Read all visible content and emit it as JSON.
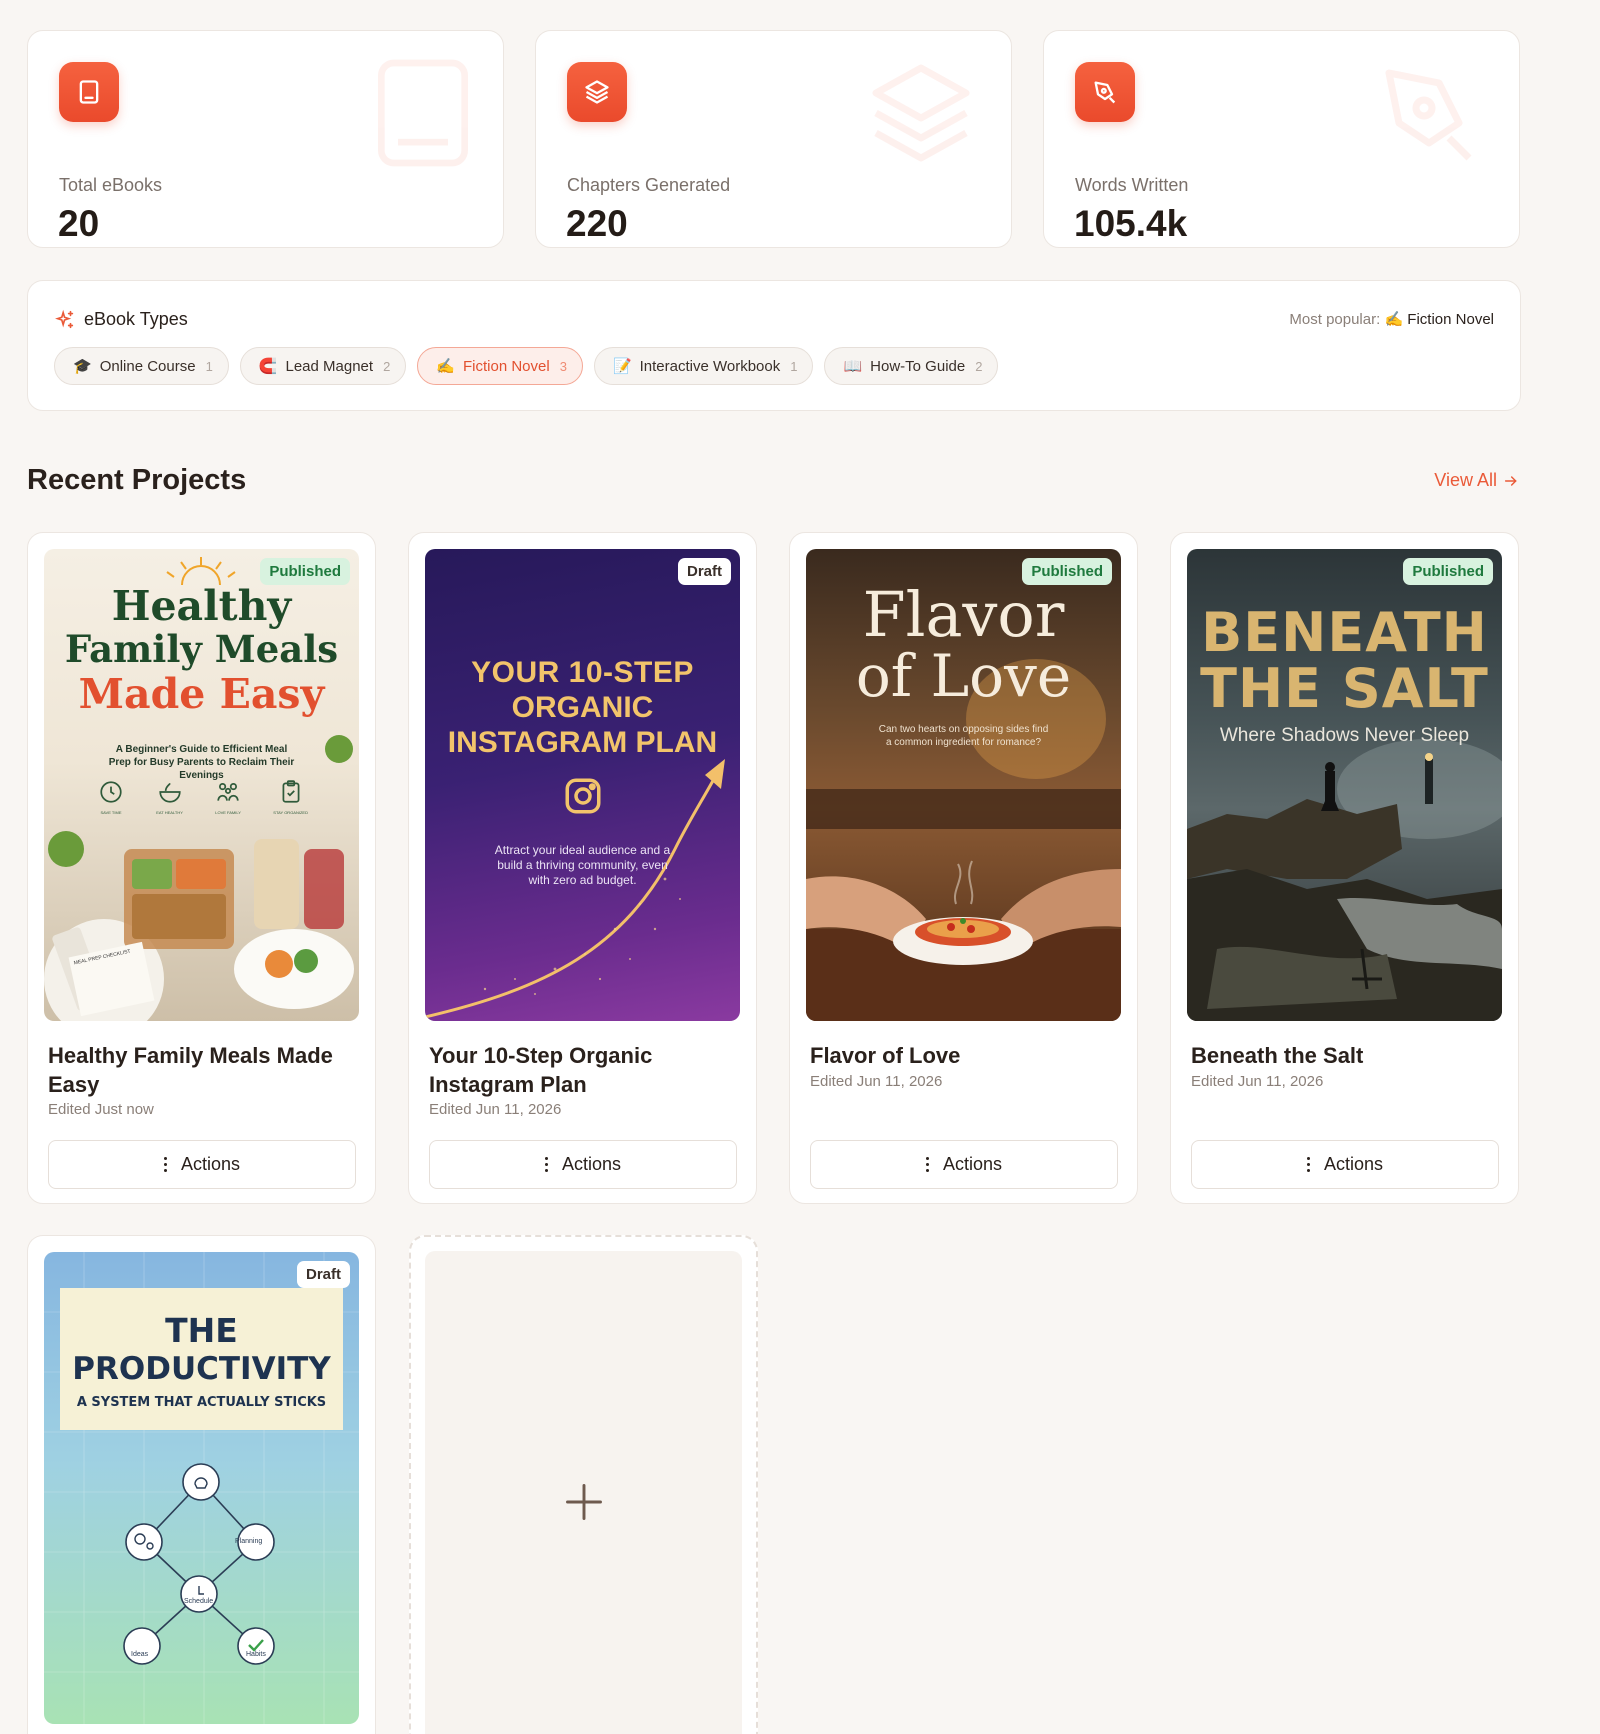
{
  "stats": [
    {
      "label": "Total eBooks",
      "value": "20",
      "icon": "book-icon"
    },
    {
      "label": "Chapters Generated",
      "value": "220",
      "icon": "layers-icon"
    },
    {
      "label": "Words Written",
      "value": "105.4k",
      "icon": "pen-nib-icon"
    }
  ],
  "types": {
    "title": "eBook Types",
    "popular_label": "Most popular:",
    "popular_value": "✍️ Fiction Novel",
    "chips": [
      {
        "emoji": "🎓",
        "label": "Online Course",
        "count": "1"
      },
      {
        "emoji": "🧲",
        "label": "Lead Magnet",
        "count": "2"
      },
      {
        "emoji": "✍️",
        "label": "Fiction Novel",
        "count": "3",
        "active": true
      },
      {
        "emoji": "📝",
        "label": "Interactive Workbook",
        "count": "1"
      },
      {
        "emoji": "📖",
        "label": "How-To Guide",
        "count": "2"
      }
    ]
  },
  "recent": {
    "title": "Recent Projects",
    "view_all": "View All"
  },
  "projects": [
    {
      "title": "Healthy Family Meals Made Easy",
      "edited": "Edited Just now",
      "status": "Published",
      "actions": "Actions",
      "cover": {
        "line1": "Healthy",
        "line2": "Family Meals",
        "line3": "Made Easy",
        "subtitle": "A Beginner's Guide to Efficient Meal Prep for Busy Parents to Reclaim Their Evenings",
        "icons": [
          "SAVE TIME",
          "EAT HEALTHY",
          "LOVE FAMILY",
          "STAY ORGANIZED"
        ],
        "notebook": "MEAL PREP CHECKLIST"
      }
    },
    {
      "title": "Your 10-Step Organic Instagram Plan",
      "edited": "Edited Jun 11, 2026",
      "status": "Draft",
      "actions": "Actions",
      "cover": {
        "line1": "YOUR 10-STEP",
        "line2": "ORGANIC",
        "line3": "INSTAGRAM PLAN",
        "subtitle": "Attract your ideal audience and a build a thriving community, even with zero ad budget."
      }
    },
    {
      "title": "Flavor of Love",
      "edited": "Edited Jun 11, 2026",
      "status": "Published",
      "actions": "Actions",
      "cover": {
        "line1": "Flavor",
        "line2": "of Love",
        "subtitle": "Can two hearts on opposing sides find a common ingredient for romance?"
      }
    },
    {
      "title": "Beneath the Salt",
      "edited": "Edited Jun 11, 2026",
      "status": "Published",
      "actions": "Actions",
      "cover": {
        "line1": "BENEATH",
        "line2": "THE SALT",
        "subtitle": "Where Shadows Never Sleep"
      }
    },
    {
      "title": "The Productivity",
      "status": "Draft",
      "cover": {
        "line1": "THE",
        "line2": "PRODUCTIVITY",
        "subtitle": "A SYSTEM THAT ACTUALLY STICKS",
        "nodes": [
          "Planning",
          "Schedule",
          "Ideas",
          "Habits"
        ]
      }
    }
  ],
  "new_project": {
    "icon": "plus-icon"
  },
  "colors": {
    "accent": "#ea5a38",
    "published_bg": "#d8f2df",
    "published_fg": "#1f7a3e",
    "bg": "#f9f6f3"
  }
}
